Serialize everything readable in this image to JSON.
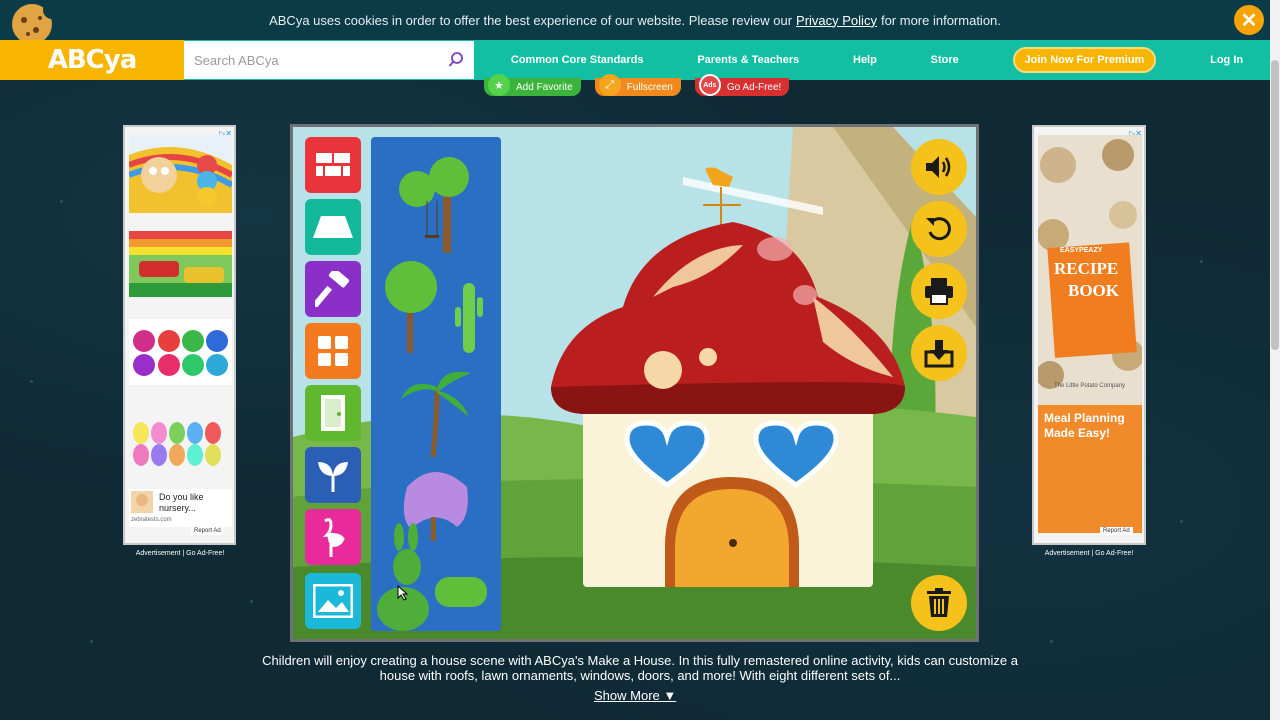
{
  "cookie_bar": {
    "text_before": "ABCya uses cookies in order to offer the best experience of our website. Please review our",
    "link": "Privacy Policy",
    "text_after": "for more information.",
    "close_icon": "close-icon"
  },
  "navbar": {
    "logo": "ABCya",
    "search_placeholder": "Search ABCya",
    "links": [
      "Common Core Standards",
      "Parents & Teachers",
      "Help",
      "Store"
    ],
    "premium": "Join Now For Premium",
    "login": "Log In"
  },
  "actions": {
    "favorite": "Add Favorite",
    "fullscreen": "Fullscreen",
    "adfree": "Go Ad-Free!",
    "adfree_badge": "Ads"
  },
  "left_ad": {
    "tile_text": "Do you like nursery...",
    "domain": "zebratests.com",
    "report": "Report Ad",
    "caption": "Advertisement | Go Ad-Free!"
  },
  "right_ad": {
    "book_brand": "EASYPEAZY",
    "book_title_1": "RECIPE",
    "book_title_2": "BOOK",
    "company": "The Little Potato Company",
    "headline": "Meal Planning Made Easy!",
    "report": "Report Ad",
    "caption": "Advertisement | Go Ad-Free!"
  },
  "game": {
    "title": "Make a House",
    "tools": [
      {
        "name": "bricks-icon",
        "color": "#e8343a"
      },
      {
        "name": "roof-icon",
        "color": "#13b79a"
      },
      {
        "name": "hammer-icon",
        "color": "#8b2fc9"
      },
      {
        "name": "window-icon",
        "color": "#f47a1f"
      },
      {
        "name": "door-icon",
        "color": "#5fb82e"
      },
      {
        "name": "plant-icon",
        "color": "#2a5fb5"
      },
      {
        "name": "flamingo-icon",
        "color": "#e92a9a"
      },
      {
        "name": "picture-icon",
        "color": "#1bb8d9"
      }
    ],
    "right_buttons": [
      "speaker-icon",
      "undo-icon",
      "print-icon",
      "download-icon"
    ],
    "trash": "trash-icon"
  },
  "description": {
    "text": "Children will enjoy creating a house scene with ABCya's Make a House. In this fully remastered online activity, kids can customize a house with roofs, lawn ornaments, windows, doors, and more! With eight different sets of...",
    "show_more": "Show More"
  }
}
